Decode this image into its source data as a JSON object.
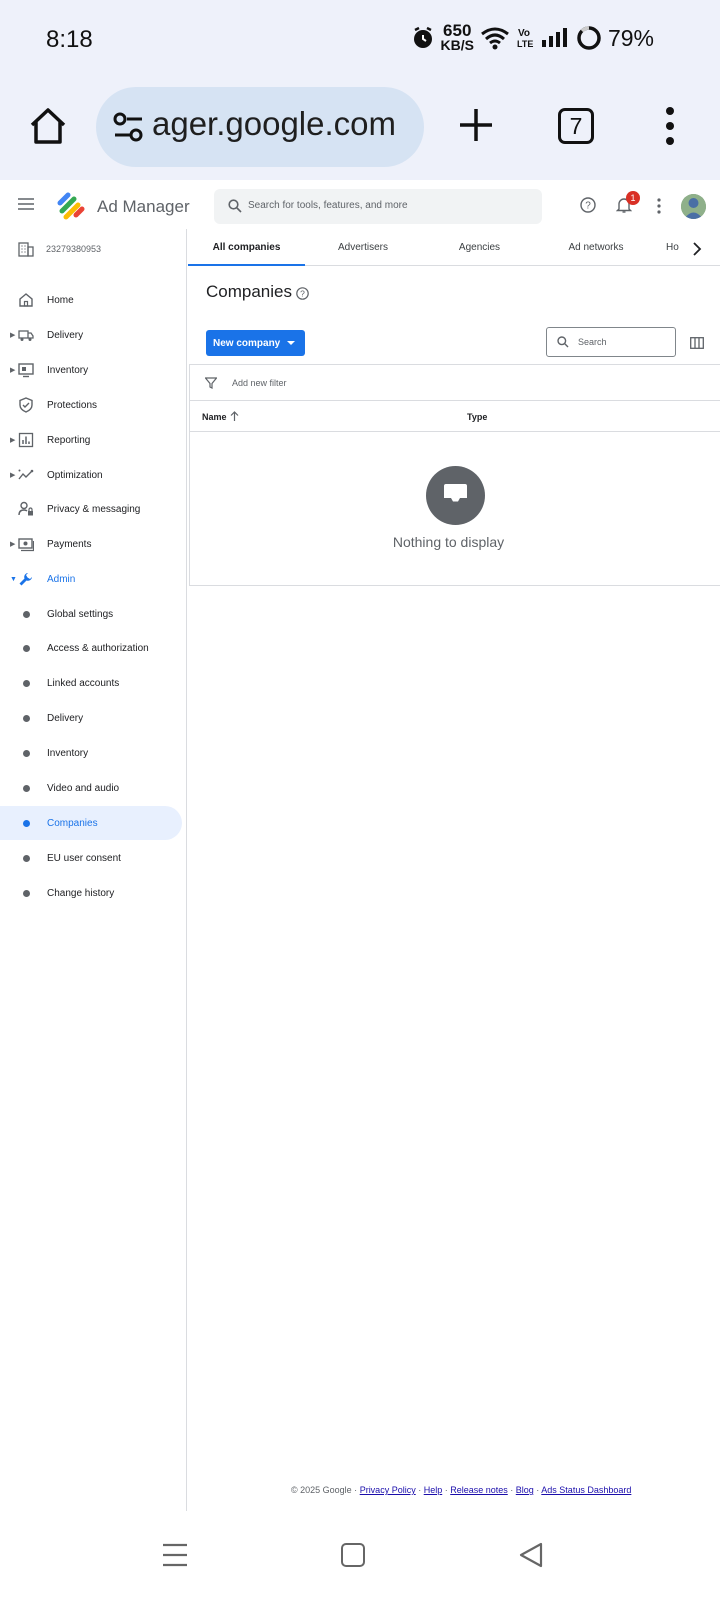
{
  "status_bar": {
    "time": "8:18",
    "speed_value": "650",
    "speed_unit": "KB/S",
    "battery": "79%"
  },
  "browser": {
    "url": "ager.google.com",
    "tab_count": "7"
  },
  "header": {
    "app_name": "Ad Manager",
    "search_placeholder": "Search for tools, features, and more",
    "notification_count": "1"
  },
  "sidebar": {
    "network_code": "23279380953",
    "items": [
      {
        "label": "Home",
        "icon": "home-icon",
        "expandable": false
      },
      {
        "label": "Delivery",
        "icon": "truck-icon",
        "expandable": true
      },
      {
        "label": "Inventory",
        "icon": "inventory-icon",
        "expandable": true
      },
      {
        "label": "Protections",
        "icon": "shield-icon",
        "expandable": false
      },
      {
        "label": "Reporting",
        "icon": "bar-chart-icon",
        "expandable": true
      },
      {
        "label": "Optimization",
        "icon": "trend-icon",
        "expandable": true
      },
      {
        "label": "Privacy & messaging",
        "icon": "person-lock-icon",
        "expandable": false
      },
      {
        "label": "Payments",
        "icon": "payments-icon",
        "expandable": true
      },
      {
        "label": "Admin",
        "icon": "wrench-icon",
        "expandable": true
      }
    ],
    "admin_subitems": [
      {
        "label": "Global settings"
      },
      {
        "label": "Access & authorization"
      },
      {
        "label": "Linked accounts"
      },
      {
        "label": "Delivery"
      },
      {
        "label": "Inventory"
      },
      {
        "label": "Video and audio"
      },
      {
        "label": "Companies"
      },
      {
        "label": "EU user consent"
      },
      {
        "label": "Change history"
      }
    ]
  },
  "main": {
    "tabs": [
      {
        "label": "All companies"
      },
      {
        "label": "Advertisers"
      },
      {
        "label": "Agencies"
      },
      {
        "label": "Ad networks"
      },
      {
        "label": "Ho"
      }
    ],
    "page_title": "Companies",
    "new_button": "New company",
    "table_search_placeholder": "Search",
    "filter_placeholder": "Add new filter",
    "columns": {
      "name": "Name",
      "type": "Type"
    },
    "empty_message": "Nothing to display"
  },
  "footer": {
    "copyright": "© 2025 Google · ",
    "links": [
      "Privacy Policy",
      "Help",
      "Release notes",
      "Blog",
      "Ads Status Dashboard"
    ]
  },
  "colors": {
    "accent": "#1a73e8",
    "browser_bg": "#eef1fa",
    "url_pill": "#d6e3f3",
    "selected_bg": "#e8f0fe",
    "badge": "#d93025"
  }
}
